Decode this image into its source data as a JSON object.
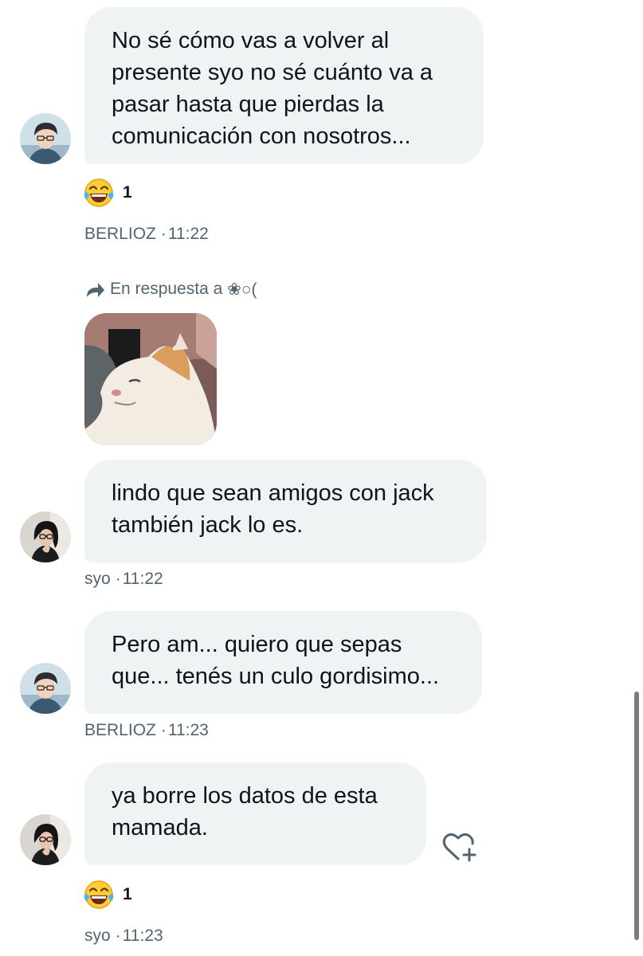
{
  "messages": [
    {
      "lines": [
        "No sé cómo vas a volver al",
        "presente syo no sé cuánto va a",
        "pasar hasta que pierdas la",
        "comunicación con nosotros..."
      ],
      "sender": "BERLIOZ",
      "time": "11:22",
      "reaction": {
        "emoji": "face-with-tears-of-joy",
        "count": "1"
      }
    },
    {
      "reply_to": {
        "label": "En respuesta a",
        "name": "❀○("
      },
      "image": {
        "description_icon": "cat-photo"
      },
      "lines": [
        "lindo que sean amigos con jack",
        "también jack lo es."
      ],
      "sender": "syo",
      "time": "11:22"
    },
    {
      "lines": [
        "Pero am... quiero que sepas",
        "que... tenés un culo gordisimo..."
      ],
      "sender": "BERLIOZ",
      "time": "11:23"
    },
    {
      "lines": [
        "ya borre los datos de esta",
        "mamada."
      ],
      "sender": "syo",
      "time": "11:23",
      "reaction": {
        "emoji": "face-with-tears-of-joy",
        "count": "1"
      }
    }
  ],
  "separator": "·",
  "colors": {
    "bubble": "#eff3f4",
    "meta_text": "#536471",
    "text": "#0f1419"
  }
}
